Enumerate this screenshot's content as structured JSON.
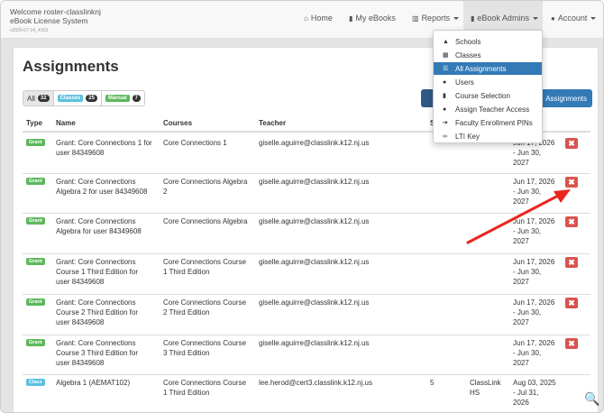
{
  "navbar": {
    "brand_line1": "Welcome roster-classlinknj",
    "brand_line2": "eBook License System",
    "version": "v2026-07-14_4153",
    "items": [
      {
        "label": "Home",
        "icon": "home-icon",
        "glyph": "⌂"
      },
      {
        "label": "My eBooks",
        "icon": "book-icon",
        "glyph": "▮"
      },
      {
        "label": "Reports",
        "icon": "chart-icon",
        "glyph": "▥"
      },
      {
        "label": "eBook Admins",
        "icon": "book-icon",
        "glyph": "▮"
      },
      {
        "label": "Account",
        "icon": "user-icon",
        "glyph": "●"
      }
    ]
  },
  "page": {
    "title": "Assignments",
    "assignments_button": "Assignments"
  },
  "filters": [
    {
      "label": "All",
      "count": "32"
    },
    {
      "label": "Classes",
      "count": "25"
    },
    {
      "label": "Manual",
      "count": "7"
    }
  ],
  "colors": {
    "grant": "#5cb85c",
    "class": "#5bc0de",
    "delete": "#d9534f",
    "primary": "#337ab7"
  },
  "table": {
    "headers": [
      "Type",
      "Name",
      "Courses",
      "Teacher",
      "S"
    ],
    "rows": [
      {
        "type": "Grant",
        "name": [
          "Grant: Core Connections 1 for",
          "user 84349608"
        ],
        "course": [
          "Core Connections 1"
        ],
        "teacher": "giselle.aguirre@classlink.k12.nj.us",
        "s": "",
        "school": [],
        "dates": [
          "Jun 17, 2026",
          "- Jun 30,",
          "2027"
        ]
      },
      {
        "type": "Grant",
        "name": [
          "Grant: Core Connections",
          "Algebra 2 for user 84349608"
        ],
        "course": [
          "Core Connections Algebra",
          "2"
        ],
        "teacher": "giselle.aguirre@classlink.k12.nj.us",
        "s": "",
        "school": [],
        "dates": [
          "Jun 17, 2026",
          "- Jun 30,",
          "2027"
        ]
      },
      {
        "type": "Grant",
        "name": [
          "Grant: Core Connections",
          "Algebra for user 84349608"
        ],
        "course": [
          "Core Connections Algebra"
        ],
        "teacher": "giselle.aguirre@classlink.k12.nj.us",
        "s": "",
        "school": [],
        "dates": [
          "Jun 17, 2026",
          "- Jun 30,",
          "2027"
        ]
      },
      {
        "type": "Grant",
        "name": [
          "Grant: Core Connections",
          "Course 1 Third Edition for",
          "user 84349608"
        ],
        "course": [
          "Core Connections Course",
          "1 Third Edition"
        ],
        "teacher": "giselle.aguirre@classlink.k12.nj.us",
        "s": "",
        "school": [],
        "dates": [
          "Jun 17, 2026",
          "- Jun 30,",
          "2027"
        ]
      },
      {
        "type": "Grant",
        "name": [
          "Grant: Core Connections",
          "Course 2 Third Edition for",
          "user 84349608"
        ],
        "course": [
          "Core Connections Course",
          "2 Third Edition"
        ],
        "teacher": "giselle.aguirre@classlink.k12.nj.us",
        "s": "",
        "school": [],
        "dates": [
          "Jun 17, 2026",
          "- Jun 30,",
          "2027"
        ]
      },
      {
        "type": "Grant",
        "name": [
          "Grant: Core Connections",
          "Course 3 Third Edition for",
          "user 84349608"
        ],
        "course": [
          "Core Connections Course",
          "3 Third Edition"
        ],
        "teacher": "giselle.aguirre@classlink.k12.nj.us",
        "s": "",
        "school": [],
        "dates": [
          "Jun 17, 2026",
          "- Jun 30,",
          "2027"
        ]
      },
      {
        "type": "Class",
        "name": [
          "Algebra 1 (AEMAT102)"
        ],
        "course": [
          "Core Connections Course",
          "1 Third Edition"
        ],
        "teacher": "lee.herod@cert3.classlink.k12.nj.us",
        "s": "5",
        "school": [
          "ClassLink",
          "HS"
        ],
        "dates": [
          "Aug 03, 2025",
          "- Jul 31,",
          "2026"
        ]
      }
    ]
  },
  "dropdown": {
    "items": [
      {
        "label": "Schools",
        "icon": "graduation-cap-icon",
        "glyph": "▲",
        "active": false
      },
      {
        "label": "Classes",
        "icon": "table-icon",
        "glyph": "▦",
        "active": false
      },
      {
        "label": "All Assignments",
        "icon": "list-icon",
        "glyph": "☰",
        "active": true
      },
      {
        "label": "Users",
        "icon": "user-icon",
        "glyph": "●",
        "active": false
      },
      {
        "label": "Course Selection",
        "icon": "book-icon",
        "glyph": "▮",
        "active": false
      },
      {
        "label": "Assign Teacher Access",
        "icon": "user-icon",
        "glyph": "●",
        "active": false
      },
      {
        "label": "Faculty Enrollment PINs",
        "icon": "sign-in-icon",
        "glyph": "➔",
        "active": false
      },
      {
        "label": "LTI Key",
        "icon": "link-icon",
        "glyph": "∞",
        "active": false
      }
    ]
  },
  "delete_glyph": "✖",
  "zoom_glyph": "🔍"
}
